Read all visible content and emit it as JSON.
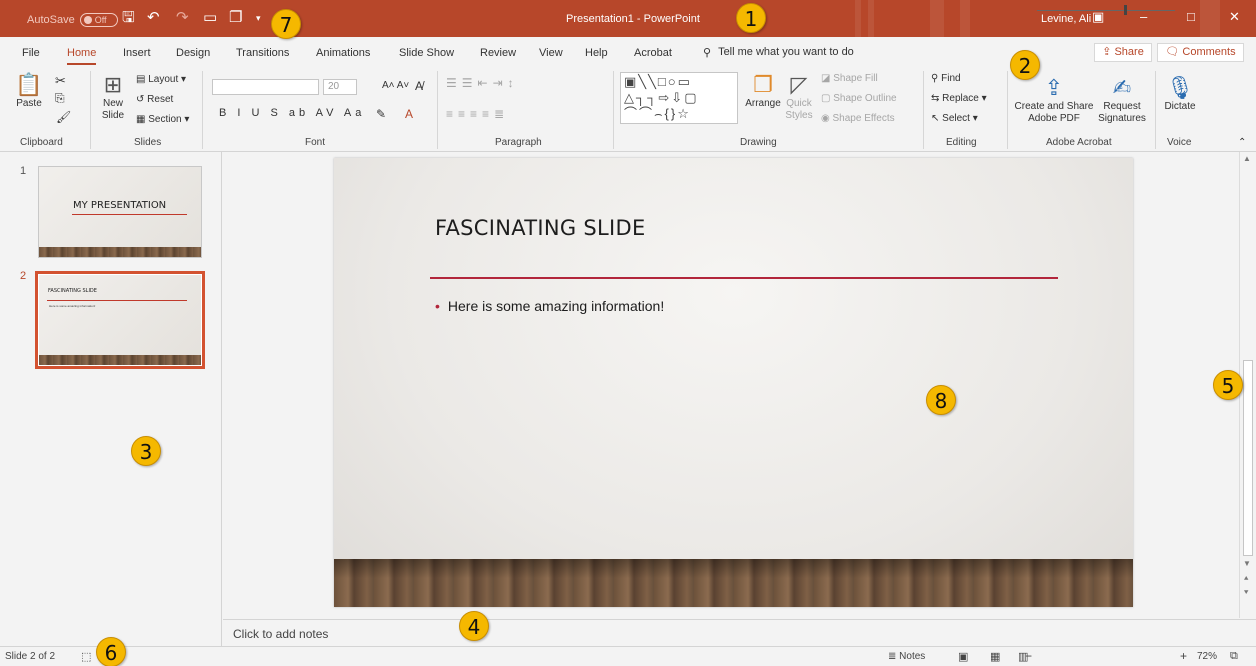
{
  "titlebar": {
    "autosave_label": "AutoSave",
    "autosave_state": "Off",
    "doc_title": "Presentation1  -  PowerPoint",
    "user": "Levine, Ali",
    "qat_icons": [
      "save-icon",
      "undo-icon",
      "redo-icon",
      "presenter-icon",
      "touch-mode-icon",
      "customize-qat-icon"
    ]
  },
  "tabs": [
    "File",
    "Home",
    "Insert",
    "Design",
    "Transitions",
    "Animations",
    "Slide Show",
    "Review",
    "View",
    "Help",
    "Acrobat"
  ],
  "active_tab": "Home",
  "tellme": "Tell me what you want to do",
  "share_label": "Share",
  "comments_label": "Comments",
  "ribbon": {
    "clipboard": {
      "paste": "Paste",
      "label": "Clipboard"
    },
    "slides": {
      "new_slide": "New",
      "new_slide2": "Slide",
      "layout": "Layout",
      "reset": "Reset",
      "section": "Section",
      "label": "Slides"
    },
    "font": {
      "size": "20",
      "label": "Font",
      "row2": "B  I  U  S  ab  AV  Aa"
    },
    "paragraph": {
      "label": "Paragraph"
    },
    "drawing": {
      "arrange": "Arrange",
      "quick_styles": "Quick",
      "quick_styles2": "Styles",
      "shape_fill": "Shape Fill",
      "shape_outline": "Shape Outline",
      "shape_effects": "Shape Effects",
      "label": "Drawing"
    },
    "editing": {
      "find": "Find",
      "replace": "Replace",
      "select": "Select",
      "label": "Editing"
    },
    "acrobat": {
      "create_share": "Create and Share",
      "create_share2": "Adobe PDF",
      "request": "Request",
      "request2": "Signatures",
      "label": "Adobe Acrobat"
    },
    "voice": {
      "dictate": "Dictate",
      "label": "Voice"
    }
  },
  "thumbnails": [
    {
      "number": "1",
      "title": "MY PRESENTATION",
      "body": ""
    },
    {
      "number": "2",
      "title": "FASCINATING SLIDE",
      "body": "Here is some amazing information!"
    }
  ],
  "slide": {
    "title": "FASCINATING SLIDE",
    "bullet": "Here is some amazing information!"
  },
  "notes_placeholder": "Click to add notes",
  "status": {
    "slide_count": "Slide 2 of 2",
    "notes": "Notes",
    "zoom": "72%"
  },
  "callouts": [
    "1",
    "2",
    "3",
    "4",
    "5",
    "6",
    "7",
    "8"
  ],
  "colors": {
    "accent": "#b7472a",
    "slide_line": "#b2263b",
    "callout": "#f5b800"
  }
}
